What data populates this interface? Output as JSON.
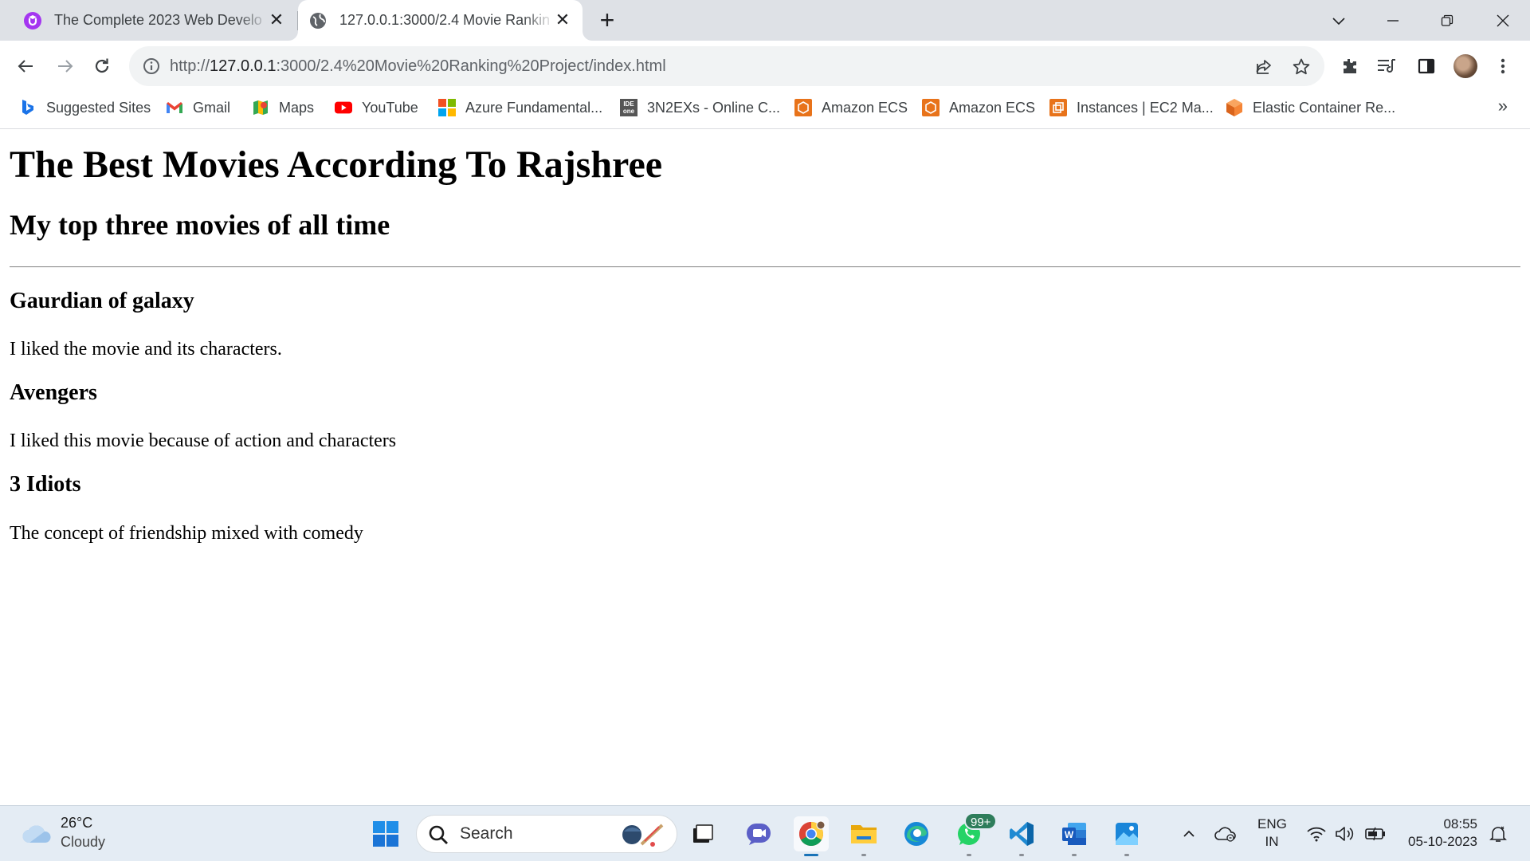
{
  "browser": {
    "tabs": [
      {
        "title": "The Complete 2023 Web Develo",
        "icon": "udemy-icon",
        "active": false
      },
      {
        "title": "127.0.0.1:3000/2.4 Movie Rankin",
        "icon": "globe-icon",
        "active": true
      }
    ],
    "address": {
      "prefix": "http://",
      "host": "127.0.0.1",
      "rest": ":3000/2.4%20Movie%20Ranking%20Project/index.html"
    },
    "bookmarks": [
      {
        "label": "Suggested Sites",
        "icon": "bing-icon"
      },
      {
        "label": "Gmail",
        "icon": "gmail-icon"
      },
      {
        "label": "Maps",
        "icon": "maps-icon"
      },
      {
        "label": "YouTube",
        "icon": "youtube-icon"
      },
      {
        "label": "Azure Fundamental...",
        "icon": "microsoft-icon"
      },
      {
        "label": "3N2EXs - Online C...",
        "icon": "ideone-icon"
      },
      {
        "label": "Amazon ECS",
        "icon": "aws-ecs-icon"
      },
      {
        "label": "Amazon ECS",
        "icon": "aws-ecs-icon"
      },
      {
        "label": "Instances | EC2 Ma...",
        "icon": "aws-ec2-icon"
      },
      {
        "label": "Elastic Container Re...",
        "icon": "aws-ecr-icon"
      }
    ],
    "bookmarks_overflow": "»"
  },
  "page": {
    "title": "The Best Movies According To Rajshree",
    "subtitle": "My top three movies of all time",
    "movies": [
      {
        "name": "Gaurdian of galaxy",
        "comment": "I liked the movie and its characters."
      },
      {
        "name": "Avengers",
        "comment": "I liked this movie because of action and characters"
      },
      {
        "name": "3 Idiots",
        "comment": "The concept of friendship mixed with comedy"
      }
    ]
  },
  "taskbar": {
    "weather": {
      "temp": "26°C",
      "condition": "Cloudy"
    },
    "search_label": "Search",
    "whatsapp_badge": "99+",
    "language": {
      "line1": "ENG",
      "line2": "IN"
    },
    "clock": {
      "time": "08:55",
      "date": "05-10-2023"
    }
  },
  "colors": {
    "tabstrip": "#dee1e6",
    "omnibox": "#f1f3f4",
    "taskbar": "#e4ecf4"
  }
}
